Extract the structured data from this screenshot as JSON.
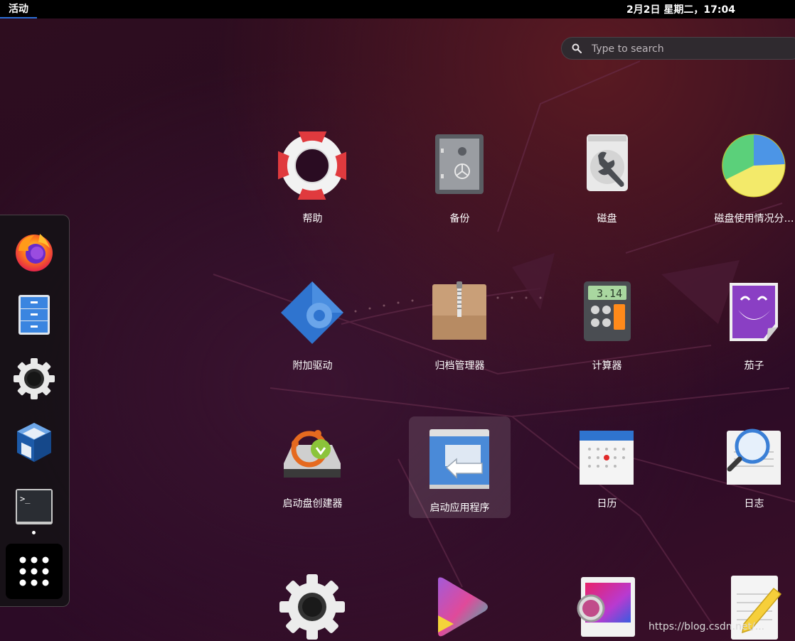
{
  "topbar": {
    "activities_label": "活动",
    "clock": "2月2日 星期二，17:04"
  },
  "search": {
    "placeholder": "Type to search",
    "icon": "search-icon"
  },
  "dock": {
    "items": [
      {
        "name": "firefox",
        "icon": "firefox-icon"
      },
      {
        "name": "files",
        "icon": "file-cabinet-icon"
      },
      {
        "name": "settings",
        "icon": "gear-icon"
      },
      {
        "name": "virtualbox",
        "icon": "virtualbox-icon"
      },
      {
        "name": "terminal",
        "icon": "terminal-icon",
        "running": true
      },
      {
        "name": "show-applications",
        "icon": "grid-icon"
      }
    ]
  },
  "apps": [
    {
      "label": "帮助",
      "icon": "lifebuoy-icon"
    },
    {
      "label": "备份",
      "icon": "safe-icon"
    },
    {
      "label": "磁盘",
      "icon": "disk-wrench-icon"
    },
    {
      "label": "磁盘使用情况分…",
      "icon": "pie-chart-icon"
    },
    {
      "label": "附加驱动",
      "icon": "chip-gear-icon"
    },
    {
      "label": "归档管理器",
      "icon": "archive-box-icon"
    },
    {
      "label": "计算器",
      "icon": "calculator-icon",
      "display": "3.14"
    },
    {
      "label": "茄子",
      "icon": "cheese-icon"
    },
    {
      "label": "启动盘创建器",
      "icon": "usb-creator-icon"
    },
    {
      "label": "启动应用程序",
      "icon": "startup-apps-icon",
      "selected": true
    },
    {
      "label": "日历",
      "icon": "calendar-icon"
    },
    {
      "label": "日志",
      "icon": "logs-magnifier-icon"
    },
    {
      "label": "",
      "icon": "gear-icon"
    },
    {
      "label": "",
      "icon": "video-play-icon"
    },
    {
      "label": "",
      "icon": "color-picture-icon"
    },
    {
      "label": "",
      "icon": "text-editor-icon"
    }
  ],
  "watermark": "https://blog.csdn.net/...",
  "colors": {
    "accent": "#2b6fd6",
    "topbar": "#000000",
    "background": "#2c0b22"
  }
}
